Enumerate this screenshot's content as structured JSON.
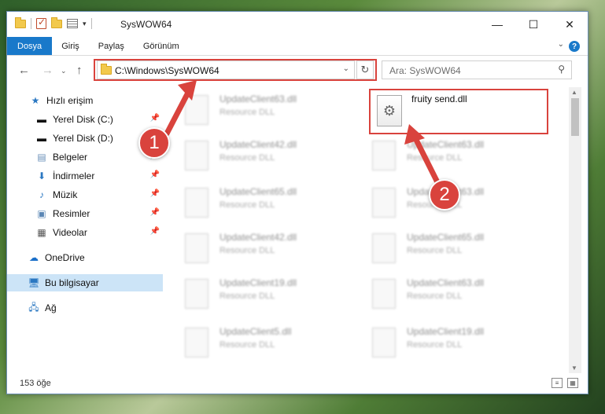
{
  "window": {
    "title": "SysWOW64",
    "buttons": {
      "minimize": "—",
      "maximize": "☐",
      "close": "✕"
    }
  },
  "ribbon": {
    "tabs": [
      "Dosya",
      "Giriş",
      "Paylaş",
      "Görünüm"
    ],
    "help": "?"
  },
  "navigation": {
    "back": "←",
    "forward": "→",
    "up": "↑",
    "address": "C:\\Windows\\SysWOW64",
    "refresh": "↻",
    "search_placeholder": "Ara: SysWOW64"
  },
  "sidebar": {
    "quick_access": "Hızlı erişim",
    "items": [
      {
        "label": "Yerel Disk (C:)",
        "icon": "drive-icon",
        "pinned": true
      },
      {
        "label": "Yerel Disk (D:)",
        "icon": "drive-icon",
        "pinned": false
      },
      {
        "label": "Belgeler",
        "icon": "documents-icon",
        "pinned": true
      },
      {
        "label": "İndirmeler",
        "icon": "download-icon",
        "pinned": true
      },
      {
        "label": "Müzik",
        "icon": "music-icon",
        "pinned": true
      },
      {
        "label": "Resimler",
        "icon": "pictures-icon",
        "pinned": true
      },
      {
        "label": "Videolar",
        "icon": "videos-icon",
        "pinned": true
      }
    ],
    "onedrive": "OneDrive",
    "this_pc": "Bu bilgisayar",
    "network": "Ağ"
  },
  "files": {
    "highlighted": {
      "name": "fruity send.dll"
    },
    "left_column": [
      {
        "name": "UpdateClient63.dll",
        "type": "Resource DLL"
      },
      {
        "name": "UpdateClient42.dll",
        "type": "Resource DLL"
      },
      {
        "name": "UpdateClient65.dll",
        "type": "Resource DLL"
      },
      {
        "name": "UpdateClient42.dll",
        "type": "Resource DLL"
      },
      {
        "name": "UpdateClient19.dll",
        "type": "Resource DLL"
      },
      {
        "name": "UpdateClient5.dll",
        "type": "Resource DLL"
      }
    ],
    "right_column": [
      {
        "name": "UpdateClient63.dll",
        "type": "Resource DLL"
      },
      {
        "name": "UpdateClient63.dll",
        "type": "Resource DLL"
      },
      {
        "name": "UpdateClient65.dll",
        "type": "Resource DLL"
      },
      {
        "name": "UpdateClient63.dll",
        "type": "Resource DLL"
      },
      {
        "name": "UpdateClient19.dll",
        "type": "Resource DLL"
      }
    ]
  },
  "status": {
    "item_count": "153 öğe"
  },
  "annotations": {
    "marker1": "1",
    "marker2": "2",
    "color": "#d9433d"
  }
}
